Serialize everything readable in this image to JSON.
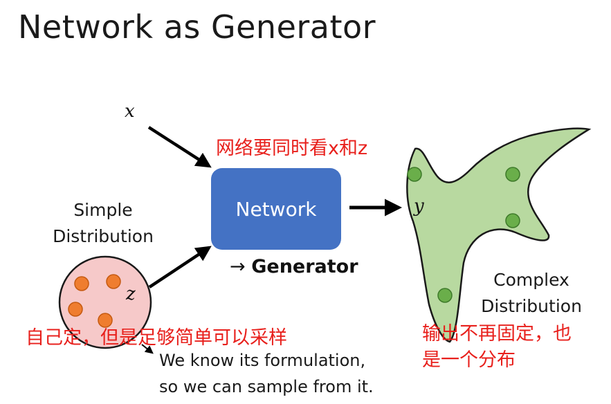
{
  "title": "Network as Generator",
  "variables": {
    "x": "x",
    "z": "z",
    "y": "y"
  },
  "network": {
    "label": "Network"
  },
  "generator": {
    "arrow": "→ ",
    "label": "Generator"
  },
  "simple_distribution": {
    "line1": "Simple",
    "line2": "Distribution"
  },
  "complex_distribution": {
    "line1": "Complex",
    "line2": "Distribution"
  },
  "notes": {
    "top": "网络要同时看x和z",
    "left": "自己定，但是足够简单可以采样",
    "right_line1": "输出不再固定，也",
    "right_line2": "是一个分布"
  },
  "formulation": {
    "line1": "We know its formulation,",
    "line2": "so we can sample from it."
  },
  "colors": {
    "network_fill": "#4472c4",
    "simple_fill": "#f6c9c9",
    "simple_dots": "#ef7d2f",
    "complex_fill": "#b8d9a0",
    "complex_dots": "#6aae4a",
    "annotation": "#e8201c"
  }
}
